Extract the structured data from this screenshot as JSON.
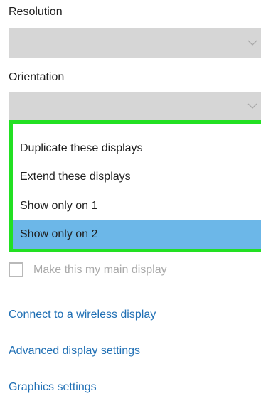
{
  "resolution": {
    "label": "Resolution",
    "value": ""
  },
  "orientation": {
    "label": "Orientation",
    "value": ""
  },
  "dropdown": {
    "items": [
      {
        "label": "Duplicate these displays"
      },
      {
        "label": "Extend these displays"
      },
      {
        "label": "Show only on 1"
      },
      {
        "label": "Show only on 2"
      }
    ],
    "selected_index": 3,
    "highlight_color": "#22e022",
    "selected_color": "#6cb7e8"
  },
  "main_display": {
    "label": "Make this my main display",
    "checked": false
  },
  "links": {
    "wireless": "Connect to a wireless display",
    "advanced": "Advanced display settings",
    "graphics": "Graphics settings"
  },
  "icons": {
    "dropdown_arrow": "chevron-down-icon"
  }
}
